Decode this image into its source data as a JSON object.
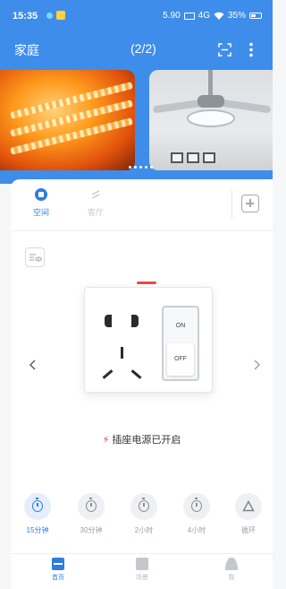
{
  "status_bar": {
    "time": "15:35",
    "net_speed": "5.90",
    "network": "4G",
    "battery": "35%"
  },
  "header": {
    "home_title": "家庭",
    "page_counter": "(2/2)",
    "icons": [
      "scan-icon",
      "more-icon"
    ]
  },
  "banners": [
    {
      "name": "led-strip-banner"
    },
    {
      "name": "ceiling-fan-banner"
    }
  ],
  "room_tabs": [
    {
      "label": "空间",
      "active": true,
      "icon": "space-icon"
    },
    {
      "label": "客厅",
      "active": false,
      "icon": "living-room-icon"
    }
  ],
  "socket": {
    "switch_on": "ON",
    "switch_off": "OFF",
    "status_text": "插座电源已开启",
    "status_icon": "lightning-icon"
  },
  "timers": [
    {
      "label": "15分钟",
      "active": true,
      "icon": "stopwatch-icon"
    },
    {
      "label": "30分钟",
      "active": false,
      "icon": "stopwatch-icon"
    },
    {
      "label": "2小时",
      "active": false,
      "icon": "stopwatch-icon"
    },
    {
      "label": "4小时",
      "active": false,
      "icon": "stopwatch-icon"
    },
    {
      "label": "循环",
      "active": false,
      "icon": "cycle-icon"
    }
  ],
  "bottom_nav": [
    {
      "label": "首页",
      "active": true,
      "icon": "home-icon"
    },
    {
      "label": "场景",
      "active": false,
      "icon": "scene-icon"
    },
    {
      "label": "我",
      "active": false,
      "icon": "profile-icon"
    }
  ],
  "colors": {
    "header_blue": "#3f8dea",
    "accent": "#2f7de1",
    "alert_red": "#e23a3a"
  }
}
